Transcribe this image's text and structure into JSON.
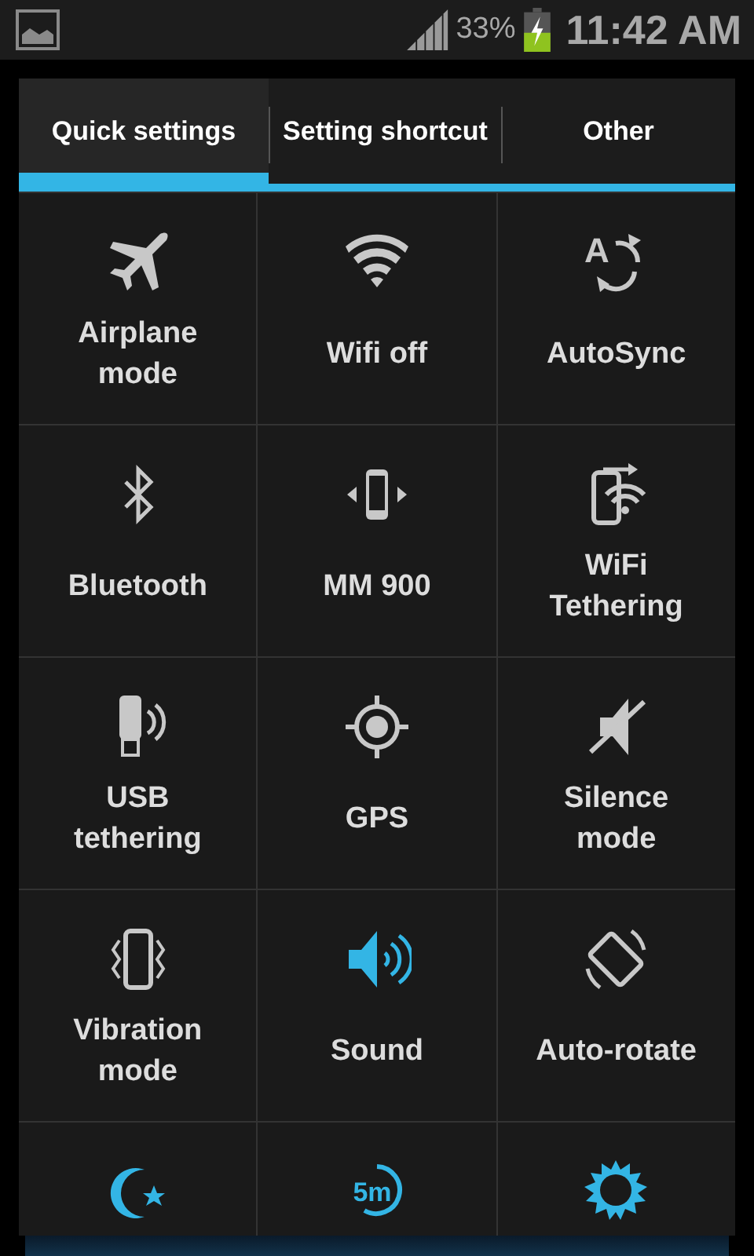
{
  "status_bar": {
    "battery": "33%",
    "time": "11:42 AM"
  },
  "tabs": [
    {
      "label": "Quick settings",
      "selected": true
    },
    {
      "label": "Setting shortcut",
      "selected": false
    },
    {
      "label": "Other",
      "selected": false
    }
  ],
  "tiles": [
    {
      "label": "Airplane mode",
      "on": false
    },
    {
      "label": "Wifi off",
      "on": false
    },
    {
      "label": "AutoSync",
      "on": false,
      "icon_text": "A"
    },
    {
      "label": "Bluetooth",
      "on": false
    },
    {
      "label": "MM 900",
      "on": false
    },
    {
      "label": "WiFi Tethering",
      "on": false
    },
    {
      "label": "USB tethering",
      "on": false
    },
    {
      "label": "GPS",
      "on": false
    },
    {
      "label": "Silence mode",
      "on": false
    },
    {
      "label": "Vibration mode",
      "on": false
    },
    {
      "label": "Sound",
      "on": true
    },
    {
      "label": "Auto-rotate",
      "on": false
    },
    {
      "on": true
    },
    {
      "on": true,
      "icon_text": "5m"
    },
    {
      "on": true
    }
  ]
}
